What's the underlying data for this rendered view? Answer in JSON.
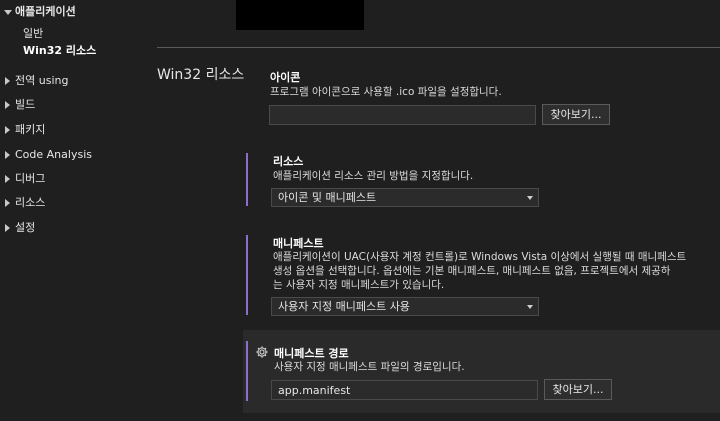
{
  "sidebar": {
    "app_group": {
      "label": "애플리케이션",
      "expanded": true
    },
    "app_children": [
      {
        "label": "일반",
        "selected": false
      },
      {
        "label": "Win32 리소스",
        "selected": true
      }
    ],
    "items": [
      {
        "label": "전역 using"
      },
      {
        "label": "빌드"
      },
      {
        "label": "패키지"
      },
      {
        "label": "Code Analysis"
      },
      {
        "label": "디버그"
      },
      {
        "label": "리소스"
      },
      {
        "label": "설정"
      }
    ]
  },
  "page": {
    "title": "Win32 리소스"
  },
  "icon_setting": {
    "title": "아이콘",
    "description": "프로그램 아이콘으로 사용할 .ico 파일을 설정합니다.",
    "value": "",
    "browse_label": "찾아보기..."
  },
  "resources_setting": {
    "title": "리소스",
    "description": "애플리케이션 리소스 관리 방법을 지정합니다.",
    "selected": "아이콘 및 매니페스트"
  },
  "manifest_setting": {
    "title": "매니페스트",
    "description_lines": [
      "애플리케이션이 UAC(사용자 계정 컨트롤)로 Windows Vista 이상에서 실행될 때 매니페스트",
      "생성 옵션을 선택합니다. 옵션에는 기본 매니페스트, 매니페스트 없음, 프로젝트에서 제공하",
      "는 사용자 지정 매니페스트가 있습니다."
    ],
    "selected": "사용자 지정 매니페스트 사용"
  },
  "manifest_path_setting": {
    "title": "매니페스트 경로",
    "description": "사용자 지정 매니페스트 파일의 경로입니다.",
    "value": "app.manifest",
    "browse_label": "찾아보기..."
  },
  "colors": {
    "background": "#1f1f1f",
    "accent": "#8a6fcf",
    "highlight_panel": "#2a2a2a"
  },
  "icons": {
    "collapsed": "caret-right",
    "expanded": "caret-down",
    "setting": "gear-icon"
  }
}
